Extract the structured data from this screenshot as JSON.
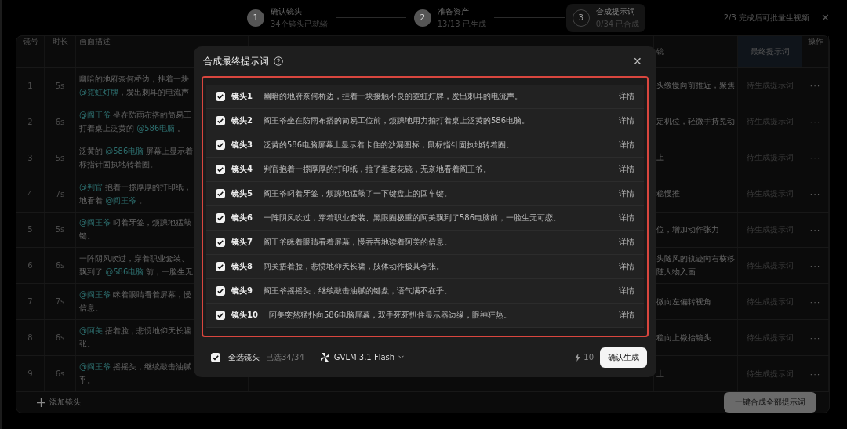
{
  "steps": [
    {
      "number": "1",
      "title": "确认镜头",
      "subtitle": "34个镜头已就绪",
      "selected": false
    },
    {
      "number": "2",
      "title": "准备资产",
      "subtitle": "13/13 已生成",
      "selected": false
    },
    {
      "number": "3",
      "title": "合成提示词",
      "subtitle": "0/34 已合成",
      "selected": true
    }
  ],
  "progress_note": "2/3 完成后可批量生视频",
  "close_label": "✕",
  "table": {
    "columns": [
      "镜号",
      "时长",
      "画面描述",
      "镜",
      "最终提示词",
      "操作"
    ],
    "rows": [
      {
        "number": "1",
        "duration": "5s",
        "description": [
          [
            {
              "text": "幽暗的地府奈何桥边，挂着一块"
            }
          ],
          [
            {
              "text": "@霓虹灯牌",
              "mention": true
            },
            {
              "text": "，发出刺耳的电流声"
            }
          ]
        ],
        "camera": [
          "头缓慢向前推近，聚焦"
        ],
        "final_prompt": "待生成提示词",
        "action": "···"
      },
      {
        "number": "2",
        "duration": "6s",
        "description": [
          [
            {
              "text": "@阎王爷",
              "mention": true
            },
            {
              "text": " 坐在防雨布搭的简易工"
            }
          ],
          [
            {
              "text": "打着桌上泛黄的 "
            },
            {
              "text": "@586电脑",
              "mention": true
            },
            {
              "text": " 。"
            }
          ]
        ],
        "camera": [
          "定机位，轻微手持晃动"
        ],
        "final_prompt": "待生成提示词",
        "action": "···"
      },
      {
        "number": "3",
        "duration": "5s",
        "description": [
          [
            {
              "text": "泛黄的 "
            },
            {
              "text": "@586电脑",
              "mention": true
            },
            {
              "text": " 屏幕上显示着"
            }
          ],
          [
            {
              "text": "标指针固执地转着圈。"
            }
          ]
        ],
        "camera": [
          "上"
        ],
        "final_prompt": "待生成提示词",
        "action": "···"
      },
      {
        "number": "4",
        "duration": "7s",
        "description": [
          [
            {
              "text": "@判官",
              "mention": true
            },
            {
              "text": " 抱着一摞厚厚的打印纸，"
            }
          ],
          [
            {
              "text": "地看着 "
            },
            {
              "text": "@阎王爷",
              "mention": true
            },
            {
              "text": " 。"
            }
          ]
        ],
        "camera": [
          "稳慢推"
        ],
        "final_prompt": "待生成提示词",
        "action": "···"
      },
      {
        "number": "5",
        "duration": "5s",
        "description": [
          [
            {
              "text": "@阎王爷",
              "mention": true
            },
            {
              "text": " 叼着牙签，烦躁地猛敲"
            }
          ],
          [
            {
              "text": "键。"
            }
          ]
        ],
        "camera": [
          "位，增加动作张力"
        ],
        "final_prompt": "待生成提示词",
        "action": "···"
      },
      {
        "number": "6",
        "duration": "6s",
        "description": [
          [
            {
              "text": "一阵阴风吹过，穿着职业套装、"
            }
          ],
          [
            {
              "text": "飘到了 "
            },
            {
              "text": "@586电脑",
              "mention": true
            },
            {
              "text": " 前，一脸生无"
            }
          ]
        ],
        "camera": [
          "头随风的轨迹向右横移",
          "随人物入画"
        ],
        "final_prompt": "待生成提示词",
        "action": "···"
      },
      {
        "number": "7",
        "duration": "7s",
        "description": [
          [
            {
              "text": "@阎王爷",
              "mention": true
            },
            {
              "text": " 眯着眼睛看着屏幕，慢"
            }
          ],
          [
            {
              "text": "信息。"
            }
          ]
        ],
        "camera": [
          "微向左偏转视角"
        ],
        "final_prompt": "待生成提示词",
        "action": "···"
      },
      {
        "number": "8",
        "duration": "6s",
        "description": [
          [
            {
              "text": "@阿美",
              "mention": true
            },
            {
              "text": " 捂着脸，悲愤地仰天长啸"
            }
          ],
          [
            {
              "text": "张。"
            }
          ]
        ],
        "camera": [
          "稳向上微抬镜头"
        ],
        "final_prompt": "待生成提示词",
        "action": "···"
      },
      {
        "number": "9",
        "duration": "6s",
        "description": [
          [
            {
              "text": "@阎王爷",
              "mention": true
            },
            {
              "text": " 摇摇头，继续敲击油腻"
            }
          ],
          [
            {
              "text": "乎。"
            }
          ]
        ],
        "camera": [
          "上"
        ],
        "final_prompt": "待生成提示词",
        "action": "···"
      }
    ]
  },
  "add_shot": "添加镜头",
  "compose_all_button": {
    "label": "一键合成全部提示词",
    "disabled": true
  },
  "dialog": {
    "title": "合成最终提示词",
    "close_label": "✕",
    "shots": [
      {
        "label": "镜头1",
        "text": "幽暗的地府奈何桥边，挂着一块接触不良的霓虹灯牌，发出刺耳的电流声。",
        "link": "详情",
        "checked": true
      },
      {
        "label": "镜头2",
        "text": "阎王爷坐在防雨布搭的简易工位前，烦躁地用力拍打着桌上泛黄的586电脑。",
        "link": "详情",
        "checked": true
      },
      {
        "label": "镜头3",
        "text": "泛黄的586电脑屏幕上显示着卡住的沙漏图标，鼠标指针固执地转着圈。",
        "link": "详情",
        "checked": true
      },
      {
        "label": "镜头4",
        "text": "判官抱着一摞厚厚的打印纸，推了推老花镜，无奈地看着阎王爷。",
        "link": "详情",
        "checked": true
      },
      {
        "label": "镜头5",
        "text": "阎王爷叼着牙签，烦躁地猛敲了一下键盘上的回车键。",
        "link": "详情",
        "checked": true
      },
      {
        "label": "镜头6",
        "text": "一阵阴风吹过，穿着职业套装、黑眼圈极重的阿美飘到了586电脑前，一脸生无可恋。",
        "link": "详情",
        "checked": true
      },
      {
        "label": "镜头7",
        "text": "阎王爷眯着眼睛看着屏幕，慢吞吞地读着阿美的信息。",
        "link": "详情",
        "checked": true
      },
      {
        "label": "镜头8",
        "text": "阿美捂着脸，悲愤地仰天长啸，肢体动作极其夸张。",
        "link": "详情",
        "checked": true
      },
      {
        "label": "镜头9",
        "text": "阎王爷摇摇头，继续敲击油腻的键盘，语气满不在乎。",
        "link": "详情",
        "checked": true
      },
      {
        "label": "镜头10",
        "text": "阿美突然猛扑向586电脑屏幕，双手死死扒住显示器边缘，眼神狂热。",
        "link": "详情",
        "checked": true
      }
    ],
    "select_all": {
      "label": "全选镜头",
      "checked": true
    },
    "selected_count": "已选34/34",
    "model": "GVLM 3.1 Flash",
    "cost": "10",
    "confirm_button": "确认生成"
  }
}
